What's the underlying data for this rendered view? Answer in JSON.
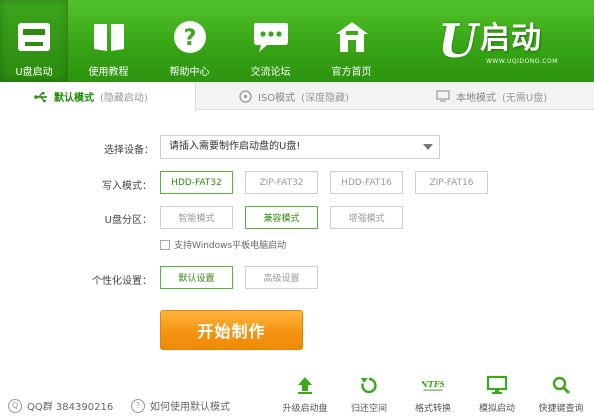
{
  "nav": [
    {
      "label": "U盘启动",
      "icon": "usb-drive-icon"
    },
    {
      "label": "使用教程",
      "icon": "book-icon"
    },
    {
      "label": "帮助中心",
      "icon": "help-icon"
    },
    {
      "label": "交流论坛",
      "icon": "chat-icon"
    },
    {
      "label": "官方首页",
      "icon": "home-icon"
    }
  ],
  "logo": {
    "text": "启动",
    "letter": "U",
    "url": "WWW.UQIDONG.COM"
  },
  "tabs": [
    {
      "label": "默认模式",
      "sub": "(隐藏启动)",
      "active": true
    },
    {
      "label": "ISO模式",
      "sub": "(深度隐藏)",
      "active": false
    },
    {
      "label": "本地模式",
      "sub": "(无需U盘)",
      "active": false
    }
  ],
  "form": {
    "device_label": "选择设备：",
    "device_value": "请插入需要制作启动盘的U盘!",
    "write_mode_label": "写入模式：",
    "write_modes": [
      "HDD-FAT32",
      "ZIP-FAT32",
      "HDD-FAT16",
      "ZIP-FAT16"
    ],
    "partition_label": "U盘分区：",
    "partition_modes": [
      "智能模式",
      "兼容模式",
      "增强模式"
    ],
    "tablet_checkbox": "支持Windows平板电脑启动",
    "custom_label": "个性化设置：",
    "custom_buttons": [
      "默认设置",
      "高级设置"
    ]
  },
  "start_button": "开始制作",
  "footer": {
    "qq": "QQ群 384390216",
    "howto": "如何使用默认模式",
    "tools": [
      {
        "label": "升级启动盘",
        "icon": "upgrade-arrow-icon"
      },
      {
        "label": "归还空间",
        "icon": "restore-icon"
      },
      {
        "label": "格式转换",
        "icon": "ntfs-icon"
      },
      {
        "label": "模拟启动",
        "icon": "monitor-icon"
      },
      {
        "label": "快捷键查询",
        "icon": "search-icon"
      }
    ]
  },
  "colors": {
    "header_green": "#37a515",
    "accent_green": "#2e8b0f",
    "start_orange": "#f59412"
  }
}
